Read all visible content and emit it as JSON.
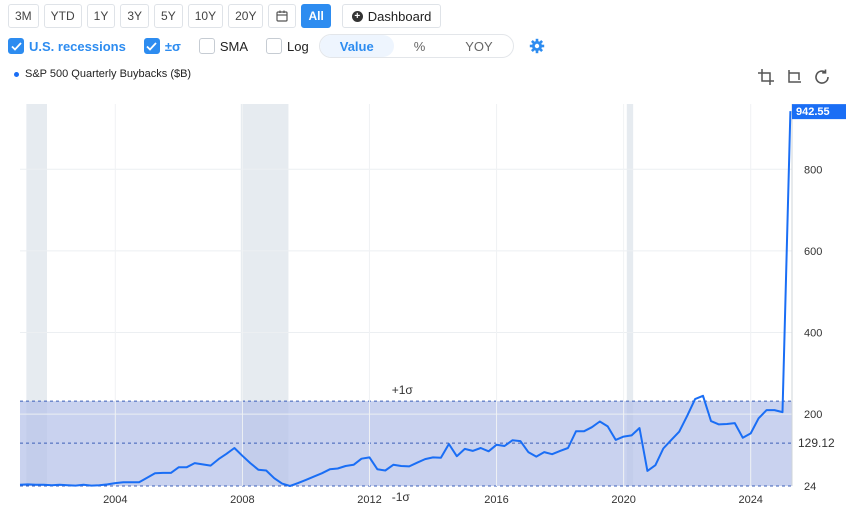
{
  "range_buttons": [
    {
      "label": "3M"
    },
    {
      "label": "YTD"
    },
    {
      "label": "1Y"
    },
    {
      "label": "3Y"
    },
    {
      "label": "5Y"
    },
    {
      "label": "10Y"
    },
    {
      "label": "20Y"
    },
    {
      "label": "All",
      "active": true
    }
  ],
  "calendar_icon": "calendar-icon",
  "dashboard_label": "Dashboard",
  "options": {
    "recessions": {
      "label": "U.S. recessions",
      "checked": true
    },
    "sigma": {
      "label": "±σ",
      "checked": true
    },
    "sma": {
      "label": "SMA",
      "checked": false
    },
    "log": {
      "label": "Log",
      "checked": false
    }
  },
  "modes": [
    {
      "label": "Value",
      "selected": true
    },
    {
      "label": "%"
    },
    {
      "label": "YOY"
    }
  ],
  "legend_label": "S&P 500 Quarterly Buybacks ($B)",
  "colors": {
    "accent": "#2d8cf0",
    "line": "#1a6ef5",
    "band": "#b7c3ea",
    "recession": "#e6ebf0"
  },
  "chart_data": {
    "type": "line",
    "series": [
      {
        "name": "S&P 500 Quarterly Buybacks ($B)",
        "x": [
          2001.0,
          2001.25,
          2001.5,
          2001.75,
          2002.0,
          2002.25,
          2002.5,
          2002.75,
          2003.0,
          2003.25,
          2003.5,
          2003.75,
          2004.0,
          2004.25,
          2004.5,
          2004.75,
          2005.0,
          2005.25,
          2005.5,
          2005.75,
          2006.0,
          2006.25,
          2006.5,
          2006.75,
          2007.0,
          2007.25,
          2007.5,
          2007.75,
          2008.0,
          2008.25,
          2008.5,
          2008.75,
          2009.0,
          2009.25,
          2009.5,
          2009.75,
          2010.0,
          2010.25,
          2010.5,
          2010.75,
          2011.0,
          2011.25,
          2011.5,
          2011.75,
          2012.0,
          2012.25,
          2012.5,
          2012.75,
          2013.0,
          2013.25,
          2013.5,
          2013.75,
          2014.0,
          2014.25,
          2014.5,
          2014.75,
          2015.0,
          2015.25,
          2015.5,
          2015.75,
          2016.0,
          2016.25,
          2016.5,
          2016.75,
          2017.0,
          2017.25,
          2017.5,
          2017.75,
          2018.0,
          2018.25,
          2018.5,
          2018.75,
          2019.0,
          2019.25,
          2019.5,
          2019.75,
          2020.0,
          2020.25,
          2020.5,
          2020.75,
          2021.0,
          2021.25,
          2021.5,
          2021.75,
          2022.0,
          2022.25,
          2022.5,
          2022.75,
          2023.0,
          2023.25,
          2023.5,
          2023.75,
          2024.0,
          2024.25,
          2024.5,
          2024.75,
          2025.0,
          2025.25
        ],
        "values": [
          27,
          28,
          27,
          27,
          26,
          27,
          26,
          25,
          27,
          25,
          26,
          28,
          31,
          33,
          33,
          33,
          44,
          55,
          56,
          56,
          70,
          70,
          80,
          77,
          74,
          90,
          103,
          117,
          98,
          80,
          64,
          62,
          43,
          30,
          24,
          31,
          39,
          47,
          55,
          65,
          67,
          73,
          76,
          91,
          94,
          65,
          62,
          76,
          73,
          72,
          81,
          90,
          94,
          93,
          127,
          97,
          115,
          110,
          117,
          109,
          125,
          122,
          136,
          134,
          107,
          96,
          107,
          102,
          110,
          117,
          158,
          158,
          168,
          182,
          170,
          137,
          145,
          148,
          166,
          61,
          75,
          116,
          137,
          157,
          196,
          237,
          245,
          183,
          175,
          176,
          178,
          142,
          153,
          190,
          210,
          210,
          205,
          942.55
        ]
      }
    ],
    "xticks": [
      2004,
      2008,
      2012,
      2016,
      2020,
      2024
    ],
    "yticks": [
      24,
      200,
      400,
      600,
      800
    ],
    "ylim": [
      24,
      960
    ],
    "xlim": [
      2001.0,
      2025.3
    ],
    "last_value": "942.55",
    "mean_value": "129.12",
    "mean": 129.12,
    "plus_sigma": 232,
    "minus_sigma": 24,
    "plus_sigma_label": "+1σ",
    "minus_sigma_label": "-1σ",
    "recessions": [
      [
        2001.2,
        2001.85
      ],
      [
        2007.95,
        2009.45
      ],
      [
        2020.1,
        2020.3
      ]
    ],
    "grid": true
  }
}
